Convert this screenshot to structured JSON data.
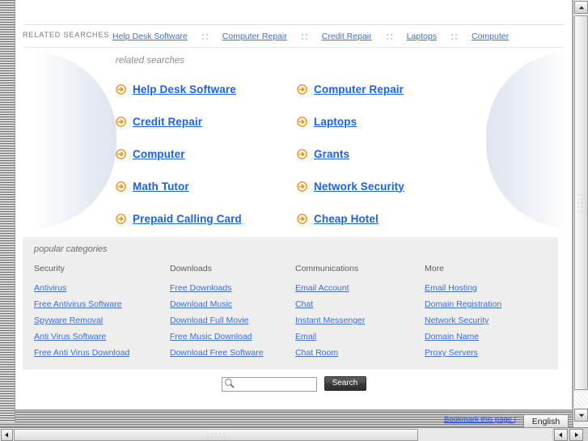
{
  "header": {
    "label": "RELATED SEARCHES",
    "separator_icon": "dot-grid-separator-icon",
    "links": [
      "Help Desk Software",
      "Computer Repair",
      "Credit Repair",
      "Laptops",
      "Computer"
    ]
  },
  "main": {
    "caption": "related searches",
    "bullet_icon": "orange-circle-arrow-icon",
    "links": [
      "Help Desk Software",
      "Computer Repair",
      "Credit Repair",
      "Laptops",
      "Computer",
      "Grants",
      "Math Tutor",
      "Network Security",
      "Prepaid Calling Card",
      "Cheap Hotel"
    ]
  },
  "categories": {
    "caption": "popular categories",
    "columns": [
      {
        "heading": "Security",
        "items": [
          "Antivirus",
          "Free Antivirus Software",
          "Spyware Removal",
          "Anti Virus Software",
          "Free Anti Virus Download"
        ]
      },
      {
        "heading": "Downloads",
        "items": [
          "Free Downloads",
          "Download Music",
          "Download Full Movie",
          "Free Music Download",
          "Download Free Software"
        ]
      },
      {
        "heading": "Communications",
        "items": [
          "Email Account",
          "Chat",
          "Instant Messenger",
          "Email",
          "Chat Room"
        ]
      },
      {
        "heading": "More",
        "items": [
          "Email Hosting",
          "Domain Registration",
          "Network Security",
          "Domain Name",
          "Proxy Servers"
        ]
      }
    ]
  },
  "search": {
    "value": "",
    "placeholder": "",
    "button_label": "Search",
    "icon": "magnifier-icon"
  },
  "footer": {
    "bookmark_label": "Bookmark this page |",
    "language": "English"
  },
  "colors": {
    "link_blue": "#3b6fd4",
    "main_link_blue": "#1a63e8",
    "arrow_orange": "#e98c1a",
    "category_panel": "#eeeeee",
    "caption_gray": "#8b8b8b",
    "search_button": "#3a3a3a"
  },
  "scrollbars": {
    "vertical_up_icon": "triangle-up-icon",
    "vertical_down_icon": "triangle-down-icon",
    "horizontal_left_icon": "triangle-left-icon",
    "horizontal_right_icon": "triangle-right-icon"
  }
}
